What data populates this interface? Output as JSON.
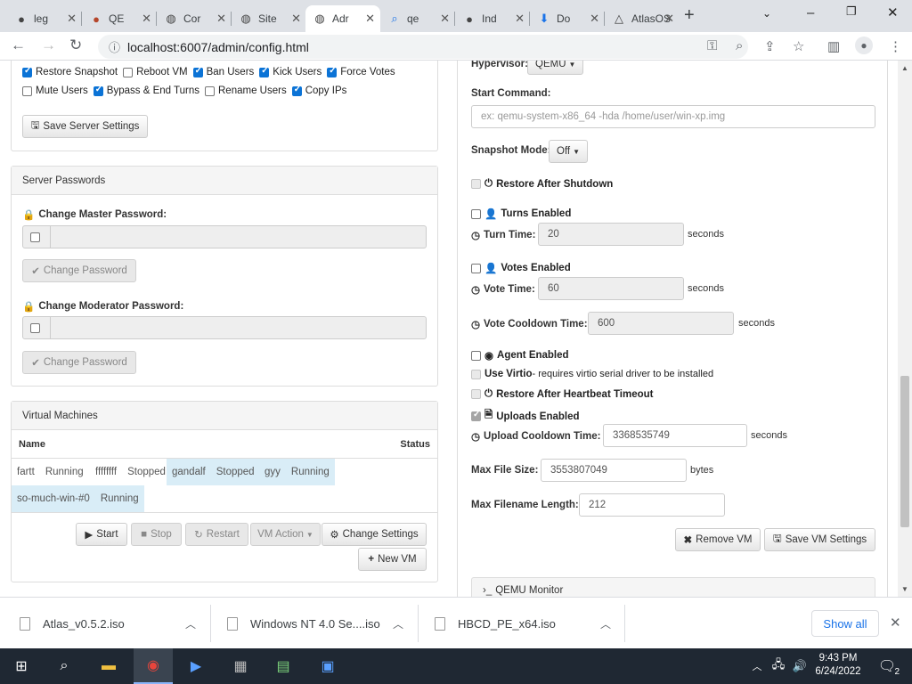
{
  "browser": {
    "tabs": [
      {
        "label": "leg",
        "icon": "github-icon"
      },
      {
        "label": "QE",
        "icon": "qemu-icon"
      },
      {
        "label": "Cor",
        "icon": "globe-icon"
      },
      {
        "label": "Site",
        "icon": "globe-icon"
      },
      {
        "label": "Adr",
        "icon": "globe-icon",
        "active": true
      },
      {
        "label": "qe",
        "icon": "search-icon"
      },
      {
        "label": "Ind",
        "icon": "github-icon"
      },
      {
        "label": "Do",
        "icon": "download-icon"
      },
      {
        "label": "AtlasOS",
        "icon": "atlas-icon"
      }
    ],
    "new_tab": "+",
    "url": "localhost:6007/admin/config.html"
  },
  "server_settings": {
    "perms_row1": [
      {
        "label": "Restore Snapshot",
        "checked": true
      },
      {
        "label": "Reboot VM",
        "checked": false
      },
      {
        "label": "Ban Users",
        "checked": true
      },
      {
        "label": "Kick Users",
        "checked": true
      },
      {
        "label": "Force Votes",
        "checked": true
      }
    ],
    "perms_row2": [
      {
        "label": "Mute Users",
        "checked": false
      },
      {
        "label": "Bypass & End Turns",
        "checked": true
      },
      {
        "label": "Rename Users",
        "checked": false
      },
      {
        "label": "Copy IPs",
        "checked": true
      }
    ],
    "save_label": "Save Server Settings"
  },
  "passwords": {
    "title": "Server Passwords",
    "master_label": "Change Master Password:",
    "moderator_label": "Change Moderator Password:",
    "change_label": "Change Password"
  },
  "vms": {
    "title": "Virtual Machines",
    "col_name": "Name",
    "col_status": "Status",
    "items": [
      {
        "name": "fartt",
        "status": "Running",
        "selected": false
      },
      {
        "name": "ffffffff",
        "status": "Stopped",
        "selected": false
      },
      {
        "name": "gandalf",
        "status": "Stopped",
        "selected": true
      },
      {
        "name": "gyy",
        "status": "Running",
        "selected": true
      },
      {
        "name": "so-much-win-#0",
        "status": "Running",
        "selected": true
      }
    ],
    "start": "Start",
    "stop": "Stop",
    "restart": "Restart",
    "vm_action": "VM Action",
    "change_settings": "Change Settings",
    "new_vm": "New VM"
  },
  "vm_settings": {
    "hypervisor_label": "Hypervisor:",
    "hypervisor_value": "QEMU",
    "start_command_label": "Start Command:",
    "start_command_placeholder": "ex: qemu-system-x86_64 -hda /home/user/win-xp.img",
    "snapshot_mode_label": "Snapshot Mode:",
    "snapshot_mode_value": "Off",
    "restore_after_shutdown": "Restore After Shutdown",
    "turns_enabled": "Turns Enabled",
    "turn_time_label": "Turn Time:",
    "turn_time": "20",
    "seconds": "seconds",
    "votes_enabled": "Votes Enabled",
    "vote_time_label": "Vote Time:",
    "vote_time": "60",
    "vote_cooldown_label": "Vote Cooldown Time:",
    "vote_cooldown": "600",
    "agent_enabled": "Agent Enabled",
    "use_virtio": "Use Virtio",
    "use_virtio_note": " - requires virtio serial driver to be installed",
    "restore_heartbeat": "Restore After Heartbeat Timeout",
    "uploads_enabled": "Uploads Enabled",
    "upload_cooldown_label": "Upload Cooldown Time:",
    "upload_cooldown": "3368535749",
    "max_file_size_label": "Max File Size:",
    "max_file_size": "3553807049",
    "bytes": "bytes",
    "max_filename_label": "Max Filename Length:",
    "max_filename": "212",
    "remove_vm": "Remove VM",
    "save_vm": "Save VM Settings",
    "qemu_monitor": "QEMU Monitor"
  },
  "downloads": {
    "items": [
      "Atlas_v0.5.2.iso",
      "Windows NT 4.0 Se....iso",
      "HBCD_PE_x64.iso"
    ],
    "show_all": "Show all"
  },
  "taskbar": {
    "time": "9:43 PM",
    "date": "6/24/2022",
    "notifications": "2"
  }
}
